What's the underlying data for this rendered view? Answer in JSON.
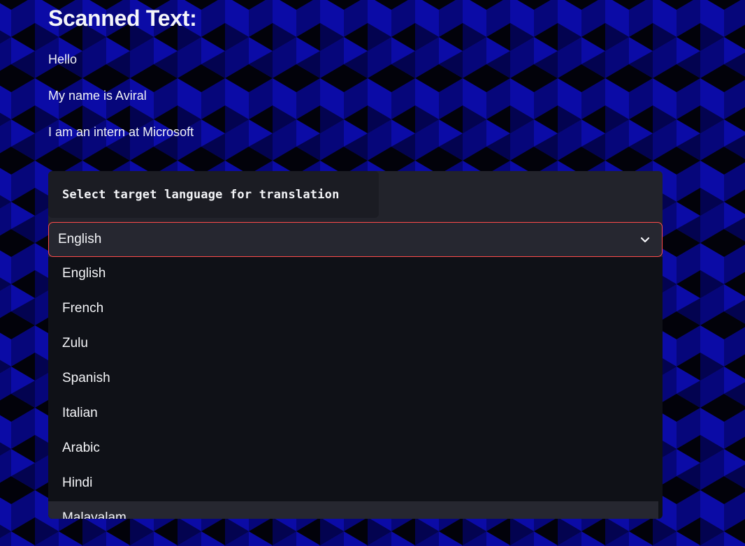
{
  "scanned": {
    "heading": "Scanned Text:",
    "lines": [
      "Hello",
      "My name is Aviral",
      "I am an intern at Microsoft"
    ]
  },
  "translate": {
    "label": "Select target language for translation",
    "selected": "English",
    "options": [
      "English",
      "French",
      "Zulu",
      "Spanish",
      "Italian",
      "Arabic",
      "Hindi",
      "Malayalam"
    ],
    "highlighted_option": "Malayalam"
  },
  "colors": {
    "background_dark": "#02020a",
    "cube_blue_light": "#0b0ba6",
    "cube_blue_mid": "#06067a",
    "cube_blue_dark": "#030350",
    "panel": "#22232b",
    "dropdown": "#0f1117",
    "focus_border": "#ff4b4b"
  },
  "icons": {
    "select_chevron": "chevron-down-icon"
  }
}
